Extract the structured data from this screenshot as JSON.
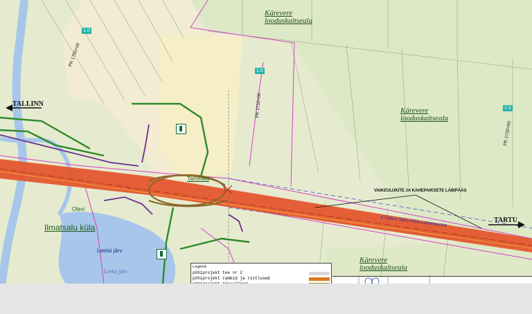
{
  "map": {
    "reserves": [
      {
        "line1": "Kärevere",
        "line2": "looduskaitseala"
      },
      {
        "line1": "Kärevere",
        "line2": "looduskaitseala"
      },
      {
        "line1": "Kärevere",
        "line2": "looduskaitseala"
      }
    ],
    "cities": {
      "tallinn": "TALLINN",
      "tartu": "TARTU"
    },
    "villages": {
      "ilmatsalu": "Ilmatsalu küla",
      "tammiku": "Tammiku",
      "olevi": "Olevi"
    },
    "lake": {
      "name": "Leetsi järv",
      "water_label": "Leetsi järv"
    },
    "project_labels": {
      "passage": "VAIKEULUKITE JA KAHEPAIKSETE LÄBIPÄÄS",
      "highway": "2 Tallinn-Tartu-Võru-Luhamaa tee",
      "pk_top": "PK 1700+00",
      "pk_mid": "PK 1710+00",
      "pk_right": "PK 1720+00"
    },
    "badges": [
      "1.0",
      "1.0",
      "1.0"
    ],
    "legend": {
      "title": "Legend",
      "rows": [
        {
          "label": "põhiprojekt tee nr 2",
          "color": "#d9d9d9"
        },
        {
          "label": "põhiprojekt rambid ja ristlused",
          "color": "#e0781c"
        },
        {
          "label": "põhiprojekt kõrvalteed",
          "color": "#b1882e"
        }
      ]
    },
    "colors": {
      "highway": "#e4572e",
      "road_green": "#2c8a2c",
      "road_purple": "#6b2c8f",
      "boundary_magenta": "#d43fc6",
      "water": "#a7c6ea",
      "forest": "#d9e6c4",
      "yellow_zone": "#f8f1c8"
    }
  }
}
